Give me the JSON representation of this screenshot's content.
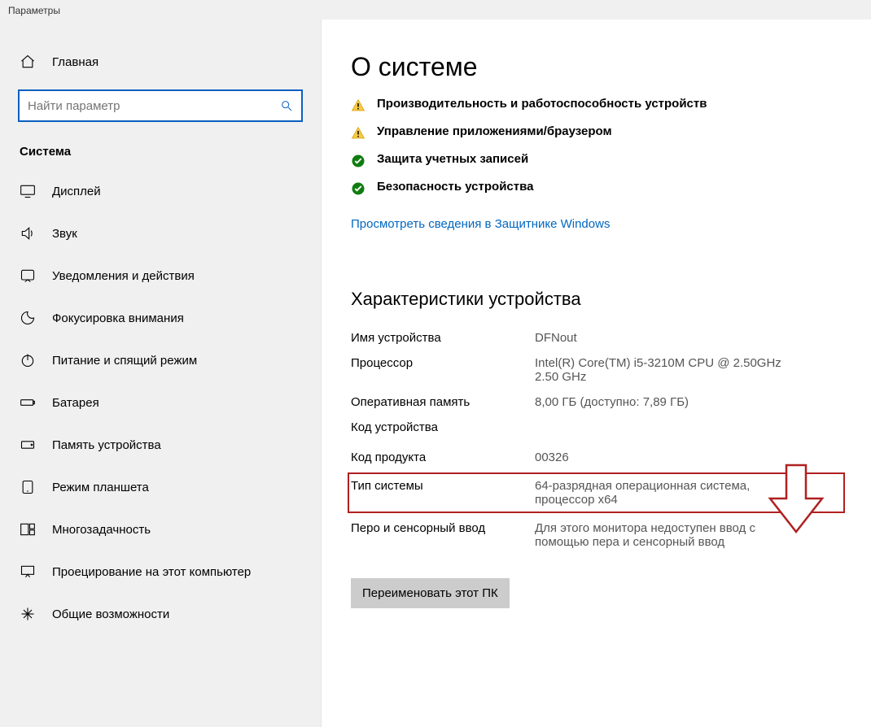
{
  "app_title": "Параметры",
  "sidebar": {
    "home": "Главная",
    "search_placeholder": "Найти параметр",
    "section": "Система",
    "items": [
      {
        "label": "Дисплей",
        "icon": "display"
      },
      {
        "label": "Звук",
        "icon": "sound"
      },
      {
        "label": "Уведомления и действия",
        "icon": "notifications"
      },
      {
        "label": "Фокусировка внимания",
        "icon": "focus"
      },
      {
        "label": "Питание и спящий режим",
        "icon": "power"
      },
      {
        "label": "Батарея",
        "icon": "battery"
      },
      {
        "label": "Память устройства",
        "icon": "storage"
      },
      {
        "label": "Режим планшета",
        "icon": "tablet"
      },
      {
        "label": "Многозадачность",
        "icon": "multitasking"
      },
      {
        "label": "Проецирование на этот компьютер",
        "icon": "projecting"
      },
      {
        "label": "Общие возможности",
        "icon": "shared"
      }
    ]
  },
  "main": {
    "title": "О системе",
    "security": [
      {
        "state": "warn",
        "text": "Производительность и работоспособность устройств"
      },
      {
        "state": "warn",
        "text": "Управление приложениями/браузером"
      },
      {
        "state": "ok",
        "text": "Защита учетных записей"
      },
      {
        "state": "ok",
        "text": "Безопасность устройства"
      }
    ],
    "defender_link": "Просмотреть сведения в Защитнике Windows",
    "spec_header": "Характеристики устройства",
    "specs": {
      "device_name_label": "Имя устройства",
      "device_name": "DFNout",
      "cpu_label": "Процессор",
      "cpu": "Intel(R) Core(TM) i5-3210M CPU @ 2.50GHz   2.50 GHz",
      "ram_label": "Оперативная память",
      "ram": "8,00 ГБ (доступно: 7,89 ГБ)",
      "device_id_label": "Код устройства",
      "device_id": "",
      "product_id_label": "Код продукта",
      "product_id": "00326",
      "system_type_label": "Тип системы",
      "system_type": "64-разрядная операционная система, процессор x64",
      "pen_label": "Перо и сенсорный ввод",
      "pen": "Для этого монитора недоступен ввод с помощью пера и сенсорный ввод"
    },
    "rename_button": "Переименовать этот ПК"
  }
}
